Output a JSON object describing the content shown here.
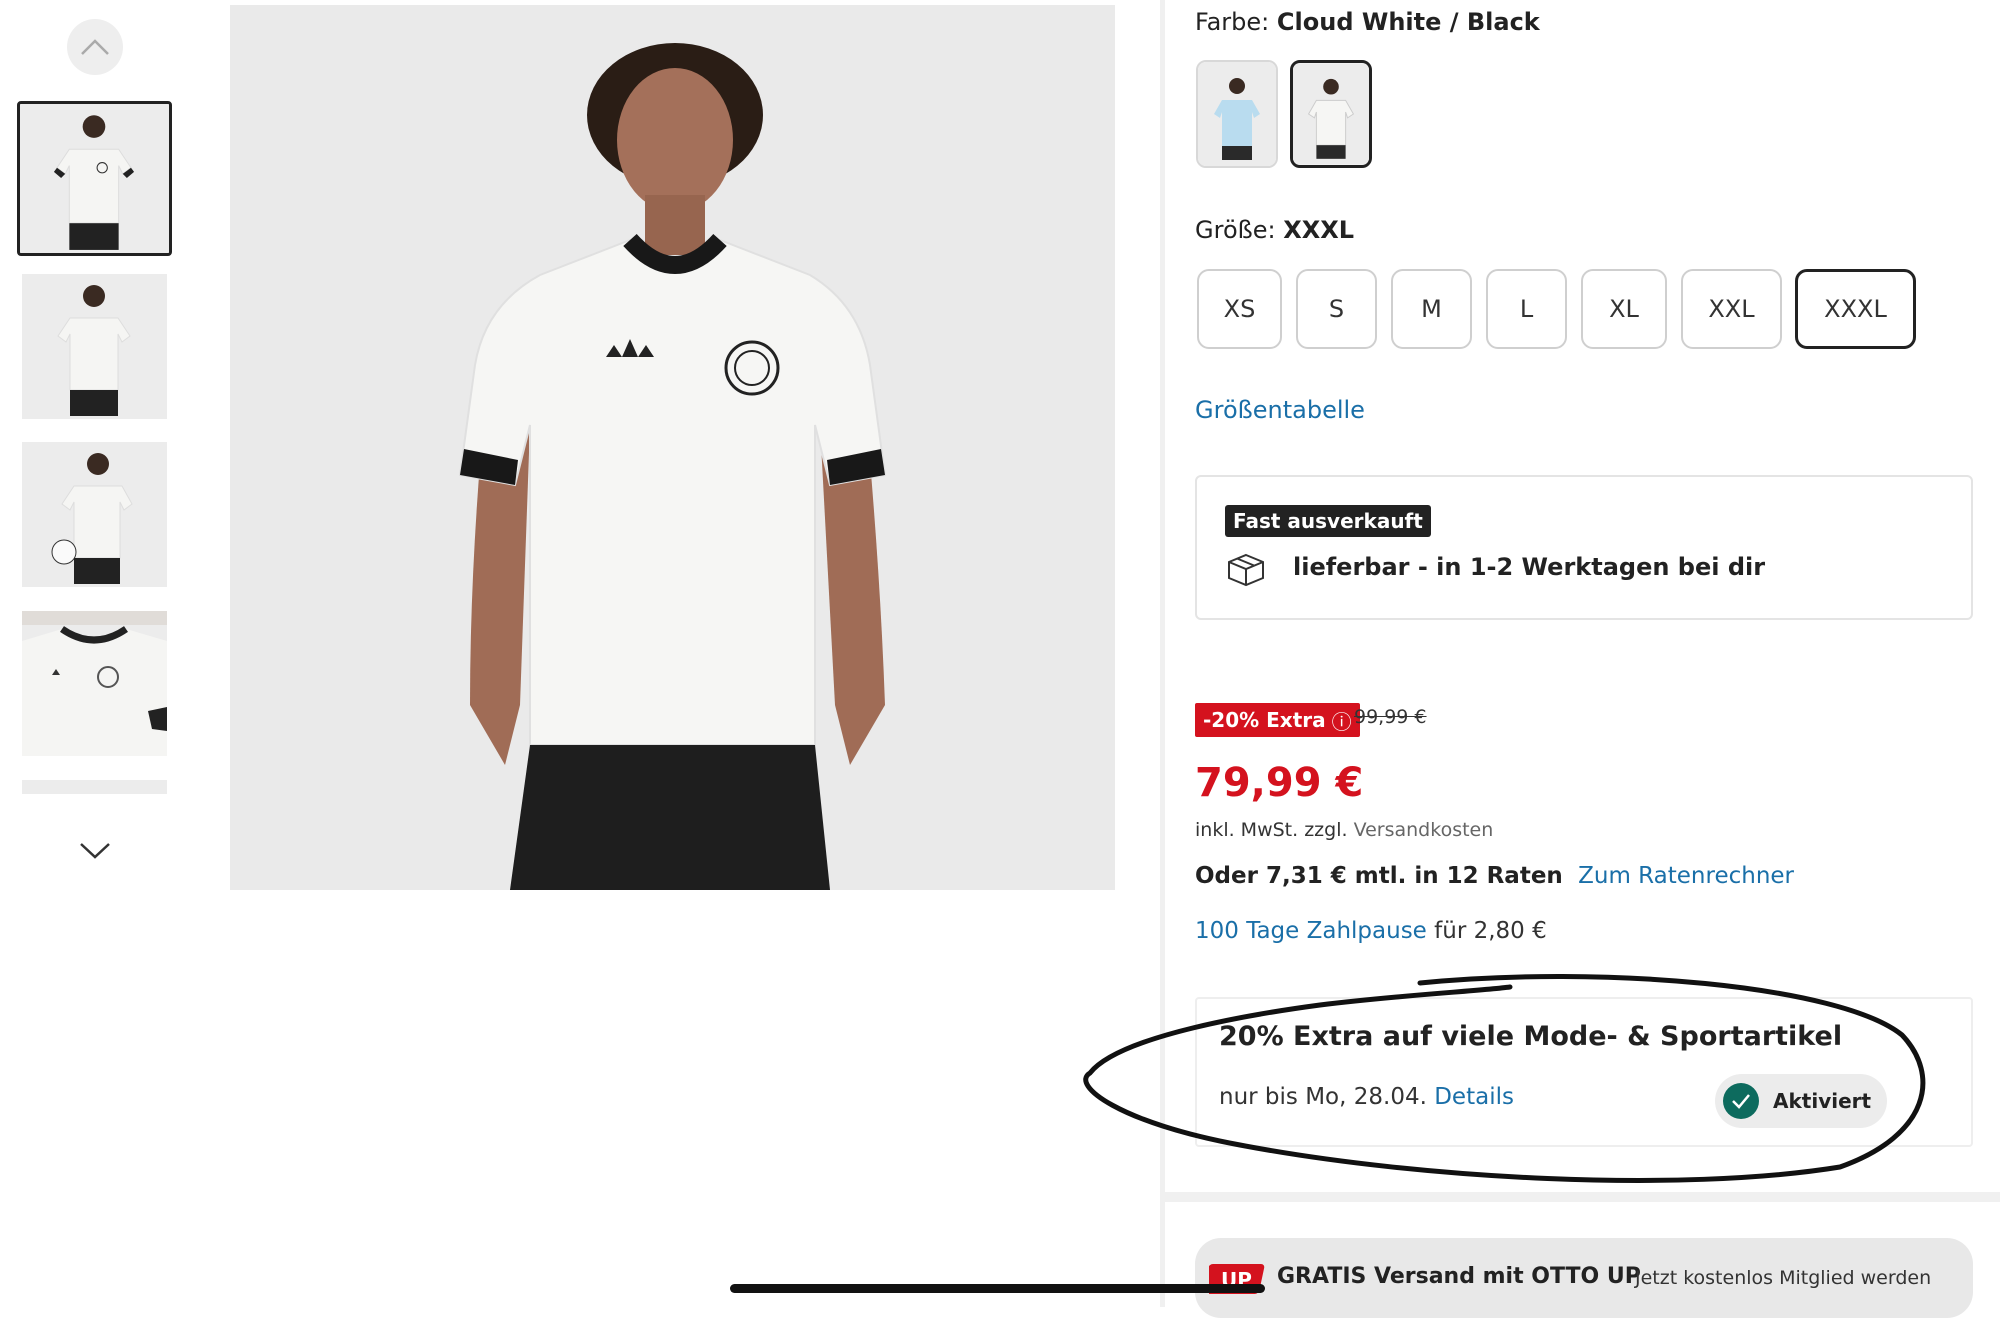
{
  "gallery": {
    "thumbnails": [
      {
        "label": "front",
        "selected": true
      },
      {
        "label": "back",
        "selected": false
      },
      {
        "label": "side with ball",
        "selected": false
      },
      {
        "label": "detail",
        "selected": false
      },
      {
        "label": "more",
        "selected": false
      }
    ],
    "scroll_up_icon": "chevron-up-icon",
    "scroll_down_icon": "chevron-down-icon"
  },
  "product": {
    "color_label": "Farbe:",
    "color_value": "Cloud White / Black",
    "color_options": [
      {
        "name": "light blue",
        "shirt_color": "#b9dcef",
        "selected": false
      },
      {
        "name": "Cloud White / Black",
        "shirt_color": "#f4f4f2",
        "selected": true
      }
    ],
    "size_label": "Größe:",
    "size_value": "XXXL",
    "sizes": [
      "XS",
      "S",
      "M",
      "L",
      "XL",
      "XXL",
      "XXXL"
    ],
    "selected_size": "XXXL",
    "size_chart_link": "Größentabelle"
  },
  "availability": {
    "badge": "Fast ausverkauft",
    "delivery_text": "lieferbar - in 1-2 Werktagen bei dir",
    "icon": "package-icon"
  },
  "pricing": {
    "discount_badge": "-20% Extra",
    "info_icon": "ⓘ",
    "old_price": "99,99 €",
    "price": "79,99 €",
    "tax_note": "inkl. MwSt. zzgl.",
    "shipping_link": "Versandkosten",
    "installment_text": "Oder 7,31 € mtl. in 12 Raten",
    "installment_link": "Zum Ratenrechner",
    "pause_link": "100 Tage Zahlpause",
    "pause_text": "für 2,80 €"
  },
  "promo": {
    "title": "20% Extra auf viele Mode- & Sportartikel",
    "valid_text": "nur bis Mo, 28.04.",
    "details_link": "Details",
    "status_button": "Aktiviert"
  },
  "up_banner": {
    "logo_text": "UP",
    "title": "GRATIS Versand mit OTTO UP",
    "subtitle": "Jetzt kostenlos Mitglied werden"
  },
  "colors": {
    "accent_red": "#d4121e",
    "link_blue": "#1a6fa8",
    "activated_green": "#0d6b5e"
  }
}
